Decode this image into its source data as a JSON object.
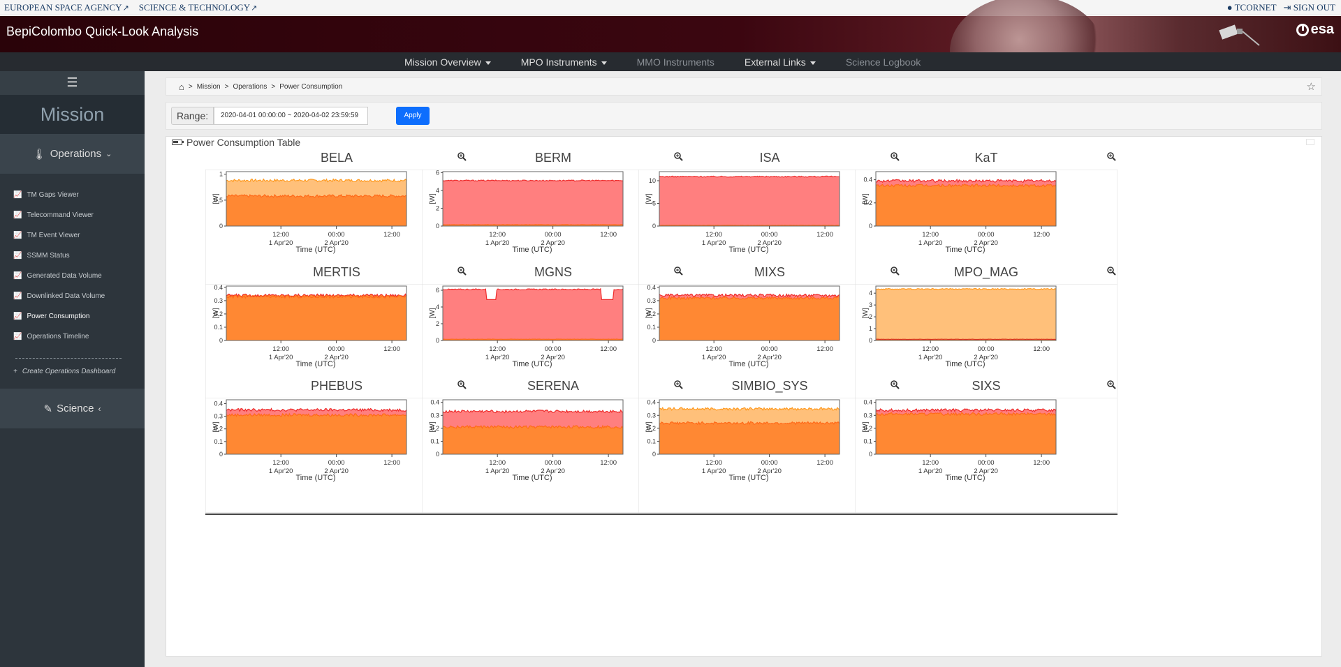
{
  "util": {
    "esa_link": "EUROPEAN SPACE AGENCY",
    "scitech_link": "SCIENCE & TECHNOLOGY",
    "user": "TCORNET",
    "signout": "SIGN OUT"
  },
  "header": {
    "title": "BepiColombo Quick-Look Analysis",
    "logo": "esa"
  },
  "nav": {
    "items": [
      {
        "label": "Mission Overview",
        "dropdown": true
      },
      {
        "label": "MPO Instruments",
        "dropdown": true
      },
      {
        "label": "MMO Instruments",
        "dropdown": false
      },
      {
        "label": "External Links",
        "dropdown": true
      },
      {
        "label": "Science Logbook",
        "dropdown": false
      }
    ]
  },
  "sidebar": {
    "section_title": "Mission",
    "operations_label": "Operations",
    "items": [
      {
        "label": "TM Gaps Viewer",
        "icon": "line-chart-icon"
      },
      {
        "label": "Telecommand Viewer",
        "icon": "line-chart-icon"
      },
      {
        "label": "TM Event Viewer",
        "icon": "line-chart-icon"
      },
      {
        "label": "SSMM Status",
        "icon": "line-chart-icon"
      },
      {
        "label": "Generated Data Volume",
        "icon": "line-chart-icon"
      },
      {
        "label": "Downlinked Data Volume",
        "icon": "line-chart-icon"
      },
      {
        "label": "Power Consumption",
        "icon": "line-chart-icon",
        "active": true
      },
      {
        "label": "Operations Timeline",
        "icon": "line-chart-icon"
      }
    ],
    "create_dashboard": "Create Operations Dashboard",
    "science_label": "Science"
  },
  "breadcrumb": [
    "Mission",
    "Operations",
    "Power Consumption"
  ],
  "range": {
    "label": "Range:",
    "value": "2020-04-01 00:00:00 ~ 2020-04-02 23:59:59",
    "apply": "Apply"
  },
  "panel": {
    "title": "Power Consumption Table"
  },
  "chart_axis": {
    "ylabel": "[W]",
    "xlabel": "Time (UTC)",
    "ticks_top": [
      "12:00",
      "00:00",
      "12:00"
    ],
    "ticks_bottom": [
      "1 Apr'20",
      "2 Apr'20"
    ]
  },
  "colors": {
    "total_line": "#ee2b2b",
    "total_fill": "#ff7f7f",
    "secondary_line": "#ff9a1f",
    "secondary_fill": "#ffc07a",
    "base_line": "#ff6a1a",
    "base_fill": "#ff8833"
  },
  "chart_data": [
    {
      "type": "area",
      "title": "BELA",
      "yticks": [
        0,
        0.5,
        1
      ],
      "ylim": [
        0,
        1.05
      ],
      "series": [
        {
          "values": [
            0.88,
            0.88
          ]
        },
        {
          "values": [
            0.58,
            0.58
          ]
        }
      ],
      "style": "orange"
    },
    {
      "type": "area",
      "title": "BERM",
      "yticks": [
        0,
        2,
        4,
        6
      ],
      "ylim": [
        0,
        6.1
      ],
      "series": [
        {
          "values": [
            5.1,
            5.1
          ]
        },
        {
          "values": [
            0.15,
            0.15
          ]
        }
      ],
      "style": "red"
    },
    {
      "type": "area",
      "title": "ISA",
      "yticks": [
        0,
        5,
        10
      ],
      "ylim": [
        0,
        12
      ],
      "series": [
        {
          "values": [
            10.9,
            10.9
          ]
        },
        {
          "values": [
            0.15,
            0.15
          ]
        }
      ],
      "style": "red"
    },
    {
      "type": "area",
      "title": "KaT",
      "yticks": [
        0,
        0.2,
        0.4
      ],
      "ylim": [
        0,
        0.47
      ],
      "series": [
        {
          "values": [
            0.39,
            0.39
          ]
        },
        {
          "values": [
            0.35,
            0.35
          ]
        }
      ],
      "style": "redorange"
    },
    {
      "type": "area",
      "title": "MERTIS",
      "yticks": [
        0,
        0.1,
        0.2,
        0.3,
        0.4
      ],
      "ylim": [
        0,
        0.41
      ],
      "series": [
        {
          "values": [
            0.34,
            0.34
          ]
        },
        {
          "values": [
            0.33,
            0.33
          ]
        }
      ],
      "style": "orangeonly"
    },
    {
      "type": "area",
      "title": "MGNS",
      "yticks": [
        0,
        2,
        4,
        6
      ],
      "ylim": [
        0,
        6.5
      ],
      "series": [
        {
          "values": [
            6.1,
            6.1
          ]
        },
        {
          "values": [
            0.15,
            0.15
          ]
        }
      ],
      "style": "mgns"
    },
    {
      "type": "area",
      "title": "MIXS",
      "yticks": [
        0,
        0.1,
        0.2,
        0.3,
        0.4
      ],
      "ylim": [
        0,
        0.41
      ],
      "series": [
        {
          "values": [
            0.34,
            0.34
          ]
        },
        {
          "values": [
            0.32,
            0.32
          ]
        }
      ],
      "style": "redorange"
    },
    {
      "type": "area",
      "title": "MPO_MAG",
      "yticks": [
        0,
        1,
        2,
        3,
        4
      ],
      "ylim": [
        0,
        4.6
      ],
      "series": [
        {
          "values": [
            4.35,
            4.35
          ]
        },
        {
          "values": [
            0.1,
            0.1
          ]
        }
      ],
      "style": "mag"
    },
    {
      "type": "area",
      "title": "PHEBUS",
      "yticks": [
        0,
        0.1,
        0.2,
        0.3,
        0.4
      ],
      "ylim": [
        0,
        0.43
      ],
      "series": [
        {
          "values": [
            0.35,
            0.35
          ]
        },
        {
          "values": [
            0.31,
            0.31
          ]
        }
      ],
      "style": "redorange"
    },
    {
      "type": "area",
      "title": "SERENA",
      "yticks": [
        0,
        0.1,
        0.2,
        0.3,
        0.4
      ],
      "ylim": [
        0,
        0.42
      ],
      "series": [
        {
          "values": [
            0.33,
            0.33
          ]
        },
        {
          "values": [
            0.21,
            0.21
          ]
        }
      ],
      "style": "red2"
    },
    {
      "type": "area",
      "title": "SIMBIO_SYS",
      "yticks": [
        0,
        0.1,
        0.2,
        0.3,
        0.4
      ],
      "ylim": [
        0,
        0.42
      ],
      "series": [
        {
          "values": [
            0.35,
            0.35
          ]
        },
        {
          "values": [
            0.24,
            0.24
          ]
        }
      ],
      "style": "orange"
    },
    {
      "type": "area",
      "title": "SIXS",
      "yticks": [
        0,
        0.1,
        0.2,
        0.3,
        0.4
      ],
      "ylim": [
        0,
        0.42
      ],
      "series": [
        {
          "values": [
            0.34,
            0.34
          ]
        },
        {
          "values": [
            0.31,
            0.31
          ]
        }
      ],
      "style": "redorange"
    }
  ]
}
